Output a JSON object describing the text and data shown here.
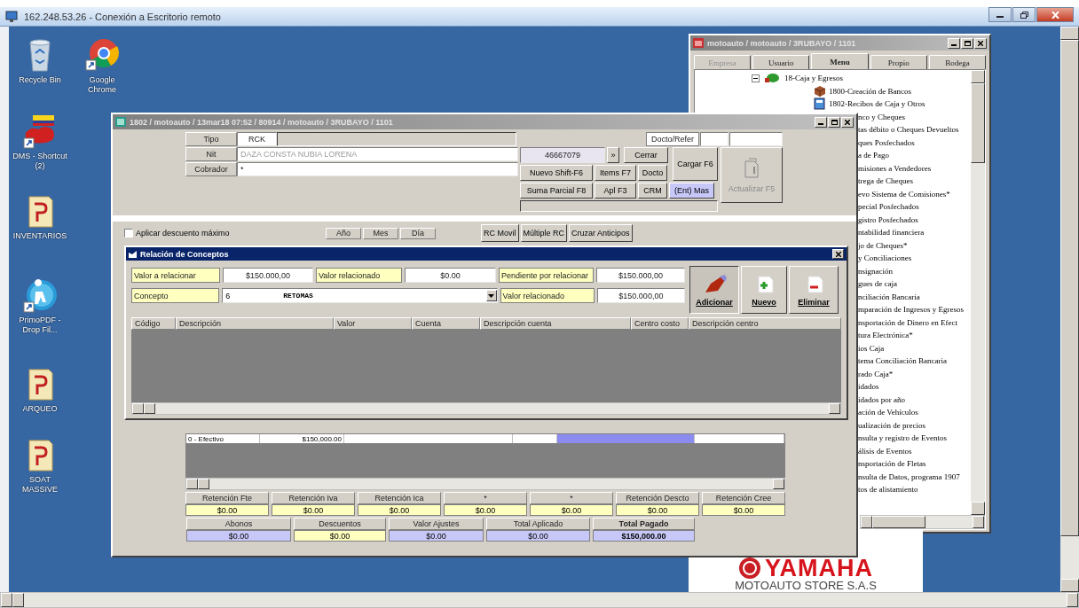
{
  "remote_desktop": {
    "title": "162.248.53.26 - Conexión a Escritorio remoto"
  },
  "desktop_icons": [
    {
      "label": "Recycle Bin",
      "kind": "recycle-bin"
    },
    {
      "label": "Google Chrome",
      "kind": "browser"
    },
    {
      "label": "DMS - Shortcut (2)",
      "kind": "flag"
    },
    {
      "label": "INVENTARIOS",
      "kind": "document"
    },
    {
      "label": "PrimoPDF - Drop Fil...",
      "kind": "round"
    },
    {
      "label": "ARQUEO",
      "kind": "document"
    },
    {
      "label": "SOAT MASSIVE",
      "kind": "document"
    }
  ],
  "menu_window": {
    "title": "motoauto / motoauto / 3RUBAYO / 1101",
    "tabs": [
      {
        "label": "Empresa",
        "selected": false,
        "disabled": true
      },
      {
        "label": "Usuario",
        "selected": false,
        "disabled": false
      },
      {
        "label": "Menu",
        "selected": true,
        "disabled": false
      },
      {
        "label": "Propio",
        "selected": false,
        "disabled": false
      },
      {
        "label": "Bodega",
        "selected": false,
        "disabled": false
      }
    ],
    "tree": [
      {
        "label": "18-Caja y Egresos",
        "expanded": true,
        "children": [
          {
            "label": "1800-Creación de Bancos",
            "kind": "package"
          },
          {
            "label": "1802-Recibos de Caja y Otros",
            "kind": "document"
          },
          {
            "label": "nco y Cheques",
            "kind": "clipped"
          },
          {
            "label": "tas débito o Cheques Devueltos",
            "kind": "clipped"
          },
          {
            "label": "ques Posfechados",
            "kind": "clipped"
          },
          {
            "label": "a de Pago",
            "kind": "clipped"
          },
          {
            "label": "misiones a Vendedores",
            "kind": "clipped"
          },
          {
            "label": "trega de Cheques",
            "kind": "clipped"
          },
          {
            "label": "evo Sistema de Comisiones*",
            "kind": "clipped"
          },
          {
            "label": "pecial Posfechados",
            "kind": "clipped"
          },
          {
            "label": "gistro Posfechados",
            "kind": "clipped"
          },
          {
            "label": "ntabilidad financiera",
            "kind": "clipped"
          },
          {
            "label": "jo de Cheques*",
            "kind": "clipped"
          },
          {
            "label": "y Conciliaciones",
            "kind": "clipped"
          },
          {
            "label": "nsignación",
            "kind": "clipped"
          },
          {
            "label": "gues de caja",
            "kind": "clipped"
          },
          {
            "label": "nciliación Bancaria",
            "kind": "clipped"
          },
          {
            "label": "mparación de Ingresos y Egresos",
            "kind": "clipped"
          },
          {
            "label": "nsportación de Dinero en Efect",
            "kind": "clipped"
          },
          {
            "label": "tura Electrónica*",
            "kind": "clipped"
          },
          {
            "label": "ios Caja",
            "kind": "clipped"
          },
          {
            "label": "tema Conciliación Bancaria",
            "kind": "clipped"
          },
          {
            "label": "rado Caja*",
            "kind": "clipped"
          },
          {
            "label": "idados",
            "kind": "clipped"
          },
          {
            "label": "idados por año",
            "kind": "clipped"
          },
          {
            "label": "ación de Vehículos",
            "kind": "clipped"
          },
          {
            "label": "ualización de precios",
            "kind": "clipped"
          },
          {
            "label": "nsulta y registro de Eventos",
            "kind": "clipped"
          },
          {
            "label": "álisis de Eventos",
            "kind": "clipped"
          },
          {
            "label": "nsportación de Fletas",
            "kind": "clipped"
          },
          {
            "label": "nsulta de Datos, programa 1907",
            "kind": "clipped"
          },
          {
            "label": "tos de alistamiento",
            "kind": "clipped"
          }
        ]
      }
    ]
  },
  "wallpaper_logo": {
    "brand": "YAMAHA",
    "store": "MOTOAUTO STORE S.A.S"
  },
  "main_window": {
    "title": "1802 / motoauto / 13mar18 07:52 / 80914 / motoauto / 3RUBAYO / 1101",
    "tipo": {
      "label": "Tipo",
      "value": "RCK"
    },
    "nit": {
      "label": "Nit",
      "value": "DAZA CONSTA NUBIA LORENA",
      "id_value": "46667079",
      "lookup": "»"
    },
    "cobrador": {
      "label": "Cobrador",
      "value": "*"
    },
    "docto_refer": {
      "label": "Docto/Refer"
    },
    "buttons": [
      {
        "label": "Cerrar",
        "disabled": false,
        "highlighted": false
      },
      {
        "label": "Cargar F6",
        "disabled": false,
        "highlighted": false
      },
      {
        "label": "Nuevo Shift-F6",
        "disabled": false,
        "highlighted": false
      },
      {
        "label": "Items F7",
        "disabled": false,
        "highlighted": false
      },
      {
        "label": "Docto",
        "disabled": false,
        "highlighted": false
      },
      {
        "label": "Suma Parcial F8",
        "disabled": false,
        "highlighted": false
      },
      {
        "label": "Apl F3",
        "disabled": false,
        "highlighted": false
      },
      {
        "label": "CRM",
        "disabled": false,
        "highlighted": false
      },
      {
        "label": "(Ent) Mas",
        "disabled": false,
        "highlighted": true
      },
      {
        "label": "Actualizar F5",
        "disabled": true,
        "highlighted": false
      }
    ],
    "discount_checkbox": {
      "label": "Aplicar descuento máximo",
      "checked": false
    },
    "date_headers": [
      "Año",
      "Mes",
      "Día"
    ],
    "action_buttons": [
      "RC Movil",
      "Múltiple RC",
      "Cruzar Anticipos"
    ],
    "payment_row": [
      {
        "text": "0 - Efectivo",
        "selected": false
      },
      {
        "text": "$150,000.00",
        "selected": false
      },
      {
        "selected": false
      },
      {
        "selected": false
      },
      {
        "selected": true
      },
      {
        "selected": false
      }
    ],
    "retentions": [
      {
        "label": "Retención Fte",
        "value": "$0.00"
      },
      {
        "label": "Retención Iva",
        "value": "$0.00"
      },
      {
        "label": "Retención Ica",
        "value": "$0.00"
      },
      {
        "label": "*",
        "value": "$0.00"
      },
      {
        "label": "*",
        "value": "$0.00"
      },
      {
        "label": "Retención Descto",
        "value": "$0.00"
      },
      {
        "label": "Retención Cree",
        "value": "$0.00"
      }
    ],
    "totals": [
      {
        "label": "Abonos",
        "value": "$0.00",
        "color": "#c8c8f8"
      },
      {
        "label": "Descuentos",
        "value": "$0.00",
        "color": "#ffffc0"
      },
      {
        "label": "Valor Ajustes",
        "value": "$0.00",
        "color": "#c8c8f8"
      },
      {
        "label": "Total Aplicado",
        "value": "$0.00",
        "color": "#c8c8f8"
      },
      {
        "label": "Total Pagado",
        "value": "$150,000.00",
        "color": "#c8c8f8"
      }
    ]
  },
  "concept_dialog": {
    "title": "Relación de Conceptos",
    "valor_a_relacionar": {
      "label": "Valor a relacionar",
      "value": "$150.000,00"
    },
    "valor_relacionado": {
      "label": "Valor relacionado",
      "value": "$0.00"
    },
    "pendiente": {
      "label": "Pendiente por relacionar",
      "value": "$150.000,00"
    },
    "concepto": {
      "label": "Concepto",
      "code": "6",
      "value": "RETOMAS"
    },
    "valor_relacionado_total": {
      "label": "Valor relacionado",
      "value": "$150.000,00"
    },
    "buttons": [
      {
        "label": "Adicionar",
        "pressed": true
      },
      {
        "label": "Nuevo",
        "pressed": false
      },
      {
        "label": "Eliminar",
        "pressed": false
      }
    ],
    "columns": [
      "Código",
      "Descripción",
      "Valor",
      "Cuenta",
      "Descripción cuenta",
      "Centro costo",
      "Descripción centro"
    ]
  }
}
